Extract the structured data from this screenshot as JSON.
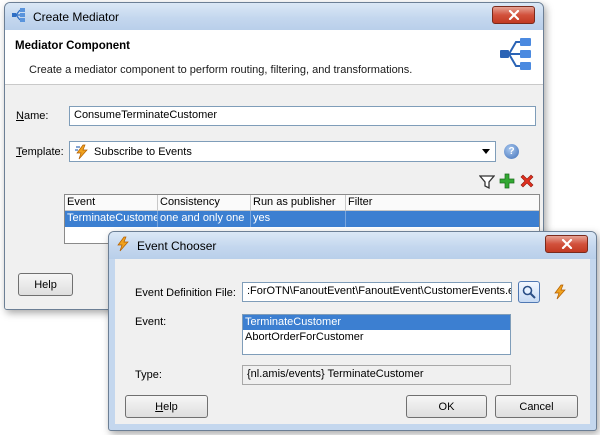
{
  "mediator_dialog": {
    "title": "Create Mediator",
    "header_title": "Mediator Component",
    "header_description": "Create a mediator component to perform routing, filtering, and transformations.",
    "name_label_mnemonic": "N",
    "name_label_rest": "ame:",
    "name_value": "ConsumeTerminateCustomer",
    "template_label_mnemonic": "T",
    "template_label_rest": "emplate:",
    "template_value": "Subscribe to Events",
    "table": {
      "columns": [
        "Event",
        "Consistency",
        "Run as publisher",
        "Filter"
      ],
      "rows": [
        [
          "TerminateCustomer",
          "one and only one",
          "yes",
          ""
        ]
      ]
    },
    "help_button": "Help"
  },
  "chooser_dialog": {
    "title": "Event Chooser",
    "edl_label": "Event Definition File:",
    "edl_value": ":ForOTN\\FanoutEvent\\FanoutEvent\\CustomerEvents.edl",
    "event_label": "Event:",
    "events": [
      {
        "label": "TerminateCustomer",
        "selected": true
      },
      {
        "label": "AbortOrderForCustomer",
        "selected": false
      }
    ],
    "type_label": "Type:",
    "type_value": "{nl.amis/events} TerminateCustomer",
    "help_mnemonic": "H",
    "help_rest": "elp",
    "ok_button": "OK",
    "cancel_button": "Cancel"
  },
  "icons": {
    "window_icon": "mediator-icon",
    "header_icon": "mediator-routing-icon",
    "template_icon": "event-bolt-icon",
    "help_icon": "help-circle-icon",
    "filter_icon": "filter-icon",
    "add_icon": "add-plus-icon",
    "delete_icon": "delete-x-icon",
    "search_icon": "search-magnifier-icon",
    "create_event_icon": "event-bolt-icon",
    "close_icon": "close-icon"
  },
  "colors": {
    "selection": "#3c7fd1",
    "close_button": "#c8452e",
    "title_bar": "#c4d7ee",
    "add_green": "#2ea02e",
    "delete_red": "#d42a1e"
  }
}
